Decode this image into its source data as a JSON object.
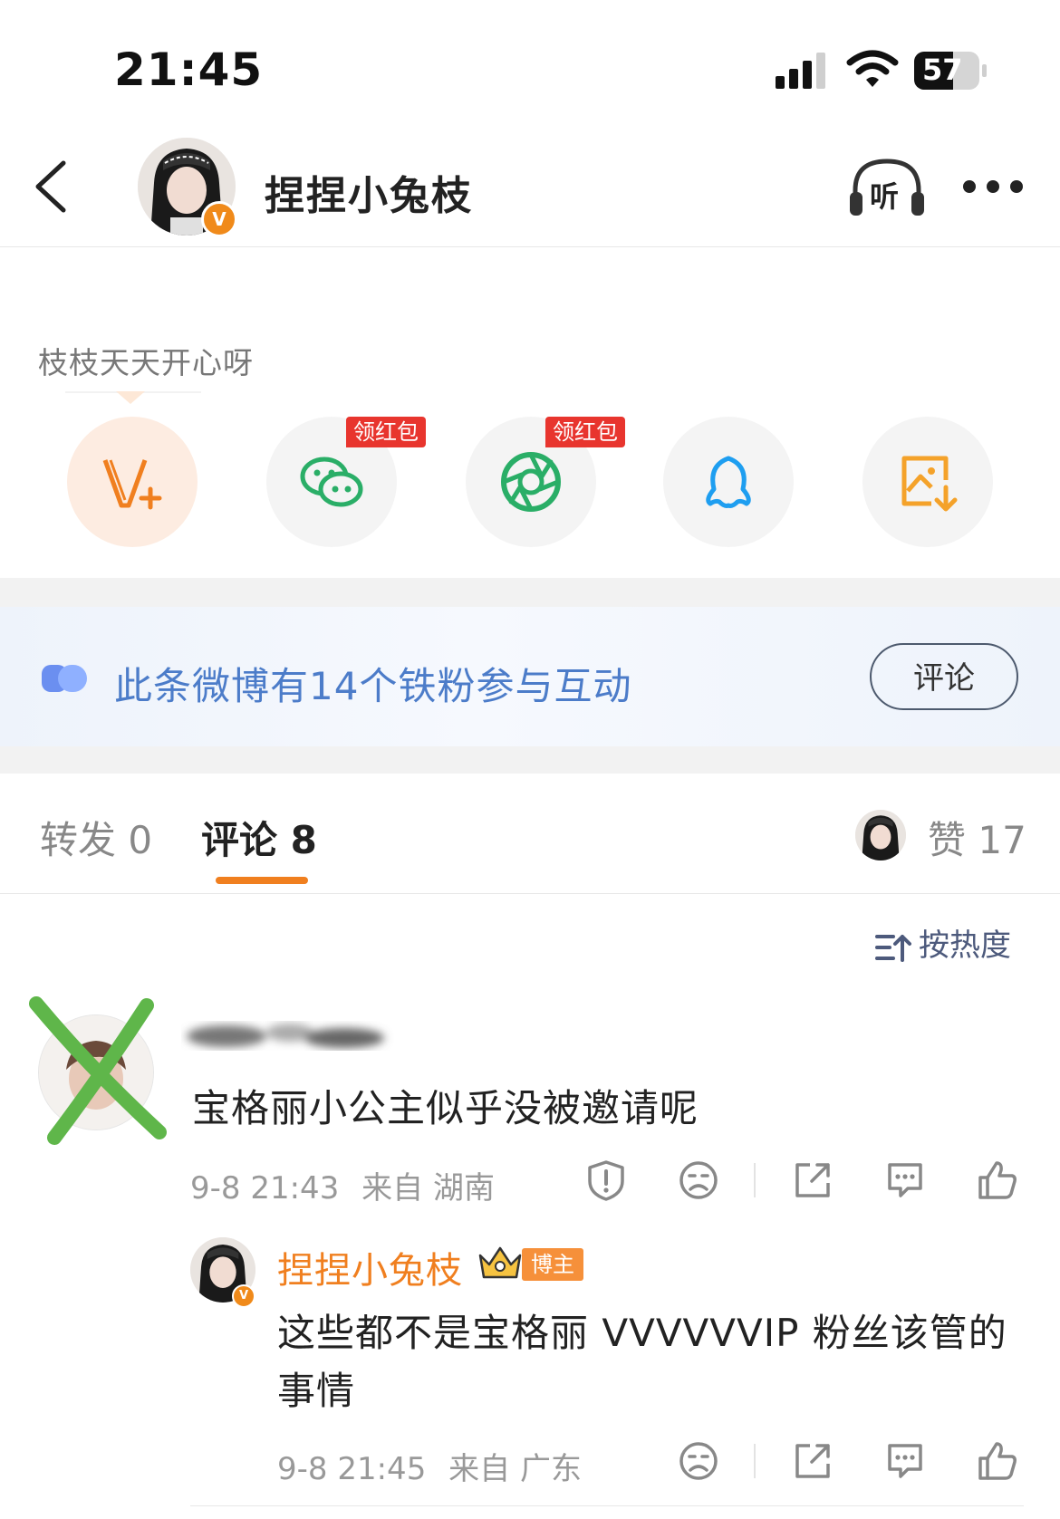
{
  "status_bar": {
    "time": "21:45",
    "battery": "57"
  },
  "header": {
    "username": "捏捏小兔枝",
    "listen_label": "听",
    "verified_mark": "V"
  },
  "post": {
    "caption": "枝枝天天开心呀"
  },
  "share": {
    "items": [
      {
        "name": "vplus"
      },
      {
        "name": "wechat",
        "tag": "领红包"
      },
      {
        "name": "moments",
        "tag": "领红包"
      },
      {
        "name": "qq"
      },
      {
        "name": "save-image"
      }
    ]
  },
  "fans_banner": {
    "text": "此条微博有14个铁粉参与互动",
    "button": "评论"
  },
  "tabs": {
    "repost": "转发 0",
    "comment": "评论 8",
    "like": "赞 17"
  },
  "sort": {
    "label": "按热度"
  },
  "comments": [
    {
      "text": "宝格丽小公主似乎没被邀请呢",
      "time": "9-8 21:43",
      "location": "来自 湖南"
    }
  ],
  "reply": {
    "username": "捏捏小兔枝",
    "badge": "博主",
    "text": "这些都不是宝格丽 VVVVVVIP 粉丝该管的事情",
    "time": "9-8 21:45",
    "location": "来自 广东"
  },
  "colors": {
    "accent_orange": "#f07f1f",
    "link_blue": "#4c7cc9",
    "red_tag": "#e8352e",
    "wechat_green": "#2aae67",
    "qq_blue": "#1e9ef0"
  }
}
